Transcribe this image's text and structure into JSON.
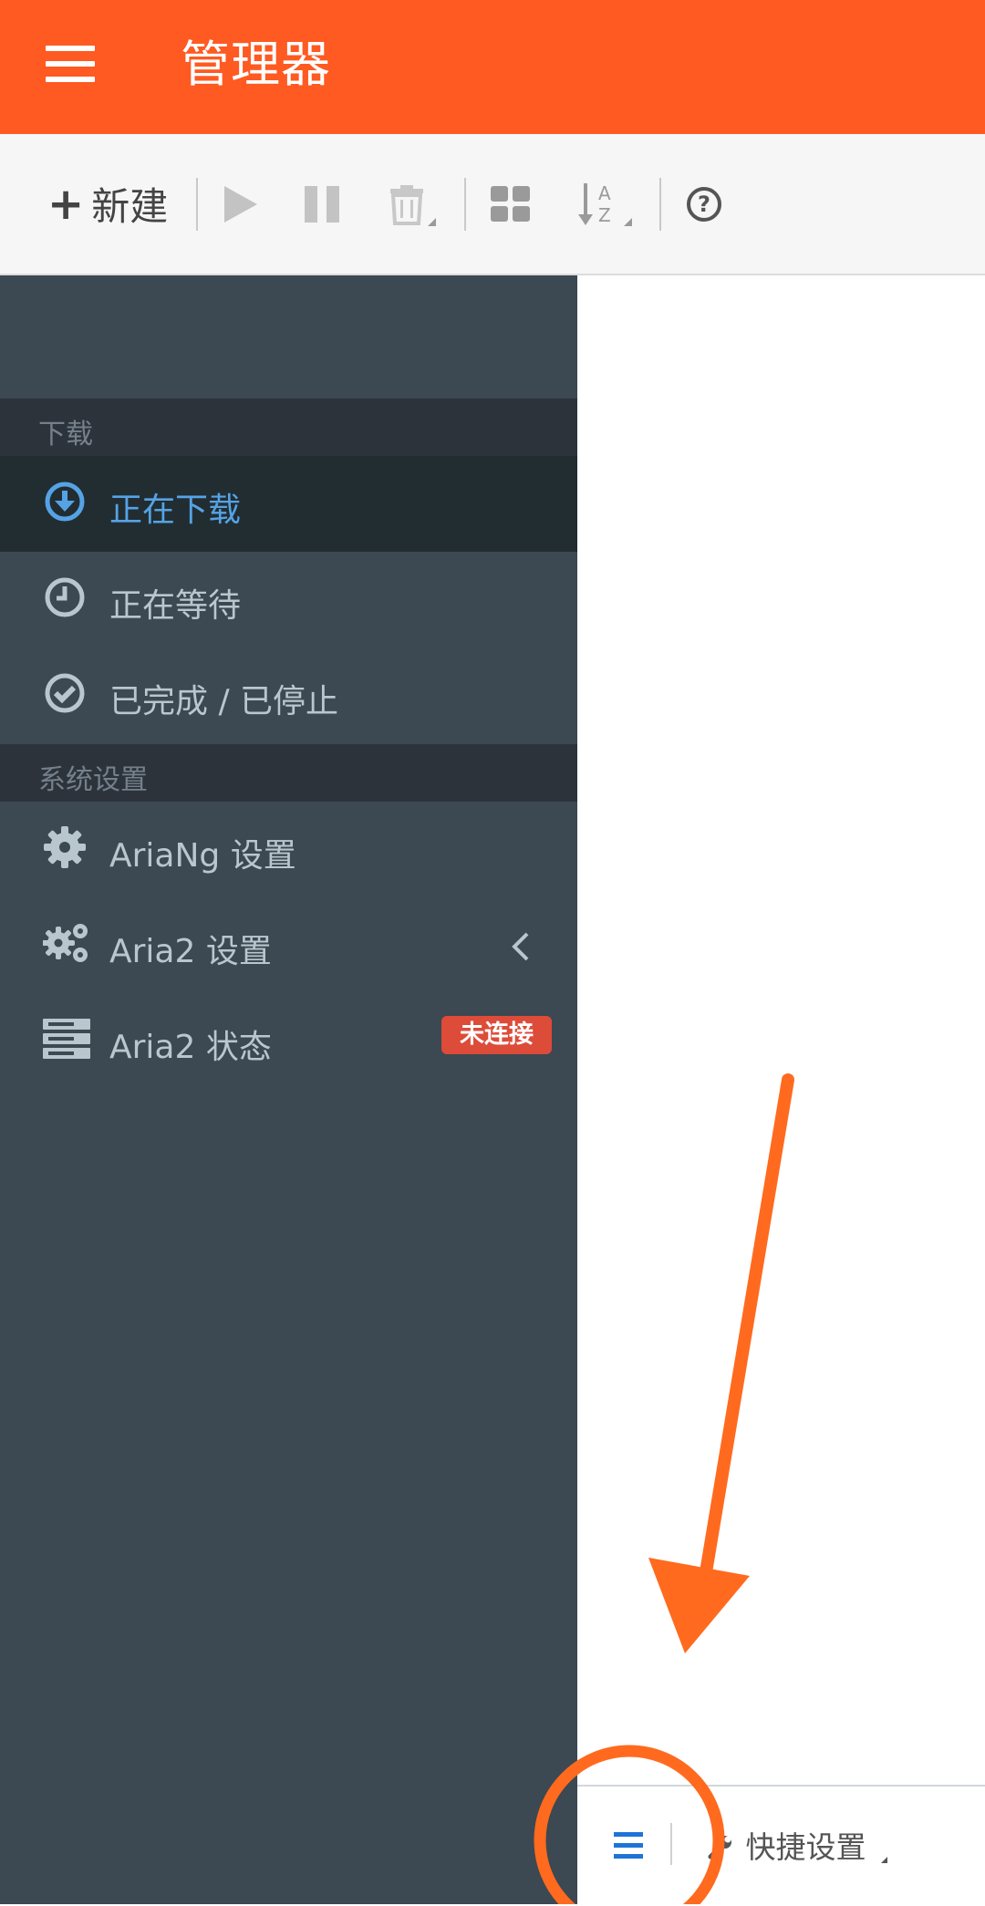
{
  "header": {
    "title": "管理器",
    "menu_icon": "hamburger-menu-icon",
    "background": "#fe5a22"
  },
  "toolbar": {
    "new_label": "新建",
    "buttons": [
      "plus-icon",
      "play-icon",
      "pause-icon",
      "trash-icon",
      "grid-icon",
      "sort-az-icon",
      "help-icon"
    ]
  },
  "sidebar": {
    "section_download": "下载",
    "items": [
      {
        "label": "正在下载",
        "icon": "download-icon",
        "active": true
      },
      {
        "label": "正在等待",
        "icon": "clock-icon"
      },
      {
        "label": "已完成 / 已停止",
        "icon": "check-circle-icon"
      }
    ],
    "section_settings": "系统设置",
    "settings": [
      {
        "label": "AriaNg 设置",
        "icon": "gear-icon"
      },
      {
        "label": "Aria2 设置",
        "icon": "gears-icon"
      },
      {
        "label": "Aria2 状态",
        "icon": "server-icon",
        "badge": "未连接"
      }
    ]
  },
  "footer": {
    "quick_settings": "快捷设置"
  },
  "colors": {
    "accent": "#fe5a22",
    "sidebar_bg": "#3c4852",
    "active_blue": "#55a3e5",
    "badge_red": "#dd4b39",
    "annotation": "#ff6a1f"
  }
}
